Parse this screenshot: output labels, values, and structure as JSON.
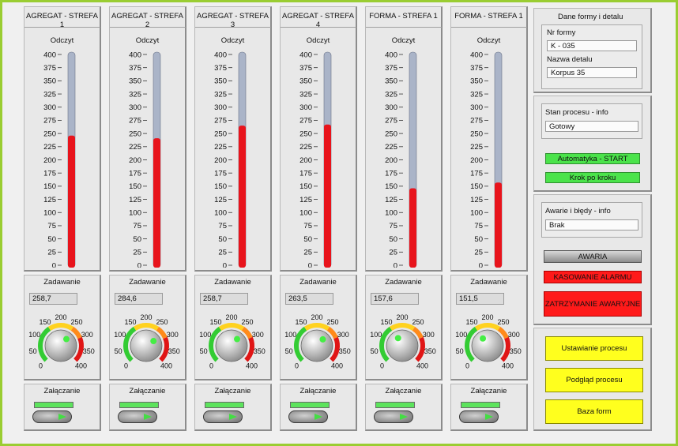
{
  "colors": {
    "mercury": "#e8141c",
    "tube_empty": "#aab4c8",
    "led_green": "#5ce35c",
    "button_green": "#4be34b",
    "button_red": "#ff1a1a",
    "button_yellow": "#ffff1e",
    "frame_green": "#9acd32"
  },
  "scale": {
    "min": 0,
    "max": 400,
    "ticks": [
      "400",
      "375",
      "350",
      "325",
      "300",
      "275",
      "250",
      "225",
      "200",
      "175",
      "150",
      "125",
      "100",
      "75",
      "50",
      "25",
      "0"
    ]
  },
  "knob_labels": {
    "t0": "0",
    "t50": "50",
    "t100": "100",
    "t150": "150",
    "t200": "200",
    "t250": "250",
    "t300": "300",
    "t350": "350",
    "t400": "400"
  },
  "zones": [
    {
      "title": "AGREGAT - STREFA 1",
      "odczyt_label": "Odczyt",
      "reading": 246,
      "zad_label": "Zadawanie",
      "setpoint": "258,7",
      "knob_value": 258.7,
      "zal_label": "Załączanie"
    },
    {
      "title": "AGREGAT - STREFA 2",
      "odczyt_label": "Odczyt",
      "reading": 241,
      "zad_label": "Zadawanie",
      "setpoint": "284,6",
      "knob_value": 284.6,
      "zal_label": "Załączanie"
    },
    {
      "title": "AGREGAT - STREFA 3",
      "odczyt_label": "Odczyt",
      "reading": 265,
      "zad_label": "Zadawanie",
      "setpoint": "258,7",
      "knob_value": 258.7,
      "zal_label": "Załączanie"
    },
    {
      "title": "AGREGAT - STREFA 4",
      "odczyt_label": "Odczyt",
      "reading": 267,
      "zad_label": "Zadawanie",
      "setpoint": "263,5",
      "knob_value": 263.5,
      "zal_label": "Załączanie"
    },
    {
      "title": "FORMA - STREFA 1",
      "odczyt_label": "Odczyt",
      "reading": 146,
      "zad_label": "Zadawanie",
      "setpoint": "157,6",
      "knob_value": 157.6,
      "zal_label": "Załączanie"
    },
    {
      "title": "FORMA - STREFA 1",
      "odczyt_label": "Odczyt",
      "reading": 157,
      "zad_label": "Zadawanie",
      "setpoint": "151,5",
      "knob_value": 151.5,
      "zal_label": "Załączanie"
    }
  ],
  "form_panel": {
    "title": "Dane formy i detalu",
    "nr_label": "Nr formy",
    "nr_value": "K - 035",
    "detail_label": "Nazwa detalu",
    "detail_value": "Korpus 35"
  },
  "process_panel": {
    "title": "Stan procesu - info",
    "status_value": "Gotowy",
    "start_button": "Automatyka - START",
    "step_button": "Krok po kroku"
  },
  "alarm_panel": {
    "title": "Awarie i błędy - info",
    "alarm_value": "Brak",
    "alarm_button": "AWARIA",
    "reset_button": "KASOWANIE ALARMU",
    "stop_button": "ZATRZYMANIE AWARYJNE"
  },
  "nav_panel": {
    "settings_button": "Ustawianie procesu",
    "preview_button": "Podgląd procesu",
    "database_button": "Baza form"
  }
}
